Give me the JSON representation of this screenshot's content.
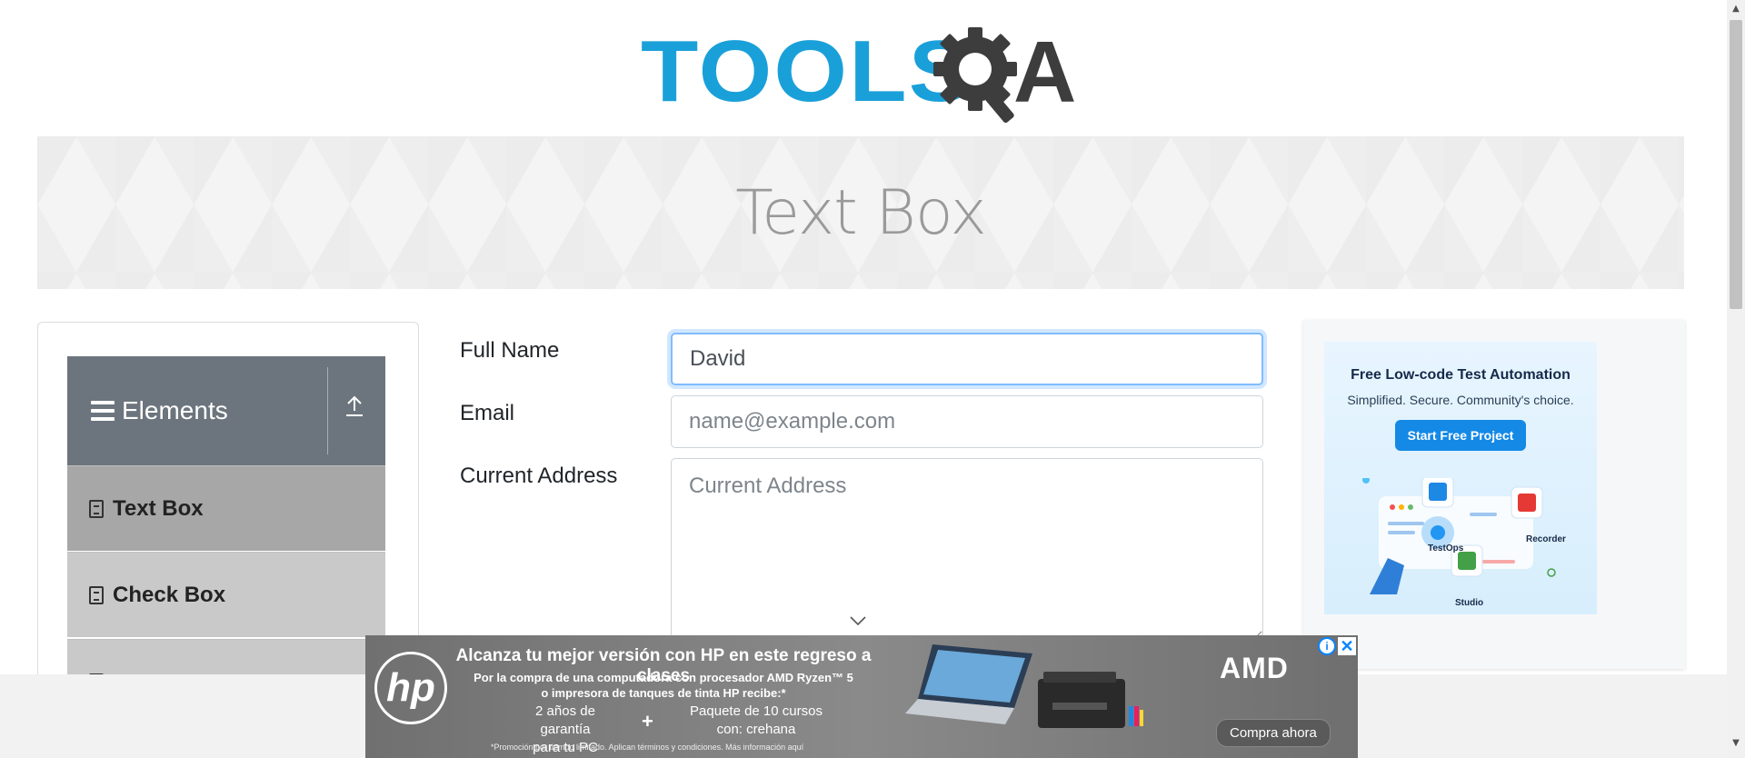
{
  "header": {
    "logo_left": "TOOLS",
    "logo_right": "A",
    "brand_colors": {
      "tools": "#1aa0d9",
      "qa": "#3d3d3d"
    }
  },
  "banner": {
    "title": "Text Box"
  },
  "sidebar": {
    "group_title": "Elements",
    "items": [
      {
        "label": "Text Box",
        "active": true
      },
      {
        "label": "Check Box",
        "active": false
      }
    ]
  },
  "form": {
    "full_name": {
      "label": "Full Name",
      "value": "David",
      "placeholder": ""
    },
    "email": {
      "label": "Email",
      "value": "",
      "placeholder": "name@example.com"
    },
    "current_address": {
      "label": "Current Address",
      "value": "",
      "placeholder": "Current Address"
    }
  },
  "ad_right": {
    "headline": "Free Low-code Test Automation",
    "subline": "Simplified. Secure. Community's choice.",
    "cta": "Start Free Project",
    "products": [
      "TestOps",
      "Recorder",
      "Studio"
    ]
  },
  "ad_bottom": {
    "headline": "Alcanza tu mejor versión con HP en este regreso a clases",
    "sub_line1": "Por la compra de una computadora con procesador AMD Ryzen™ 5",
    "sub_line2": "o impresora de tanques de tinta HP recibe:*",
    "offer1_line1": "2 años de garantía",
    "offer1_line2": "para tu PC",
    "plus": "+",
    "offer2_line1": "Paquete de 10 cursos",
    "offer2_line2": "con: crehana",
    "fine_print": "*Promoción por tiempo limitado. Aplican términos y condiciones. Más información aquí",
    "hp_logo": "hp",
    "amd_logo": "AMD",
    "cta": "Compra ahora",
    "adchoices": "i",
    "close": "✕"
  },
  "icons": {
    "hamburger": "hamburger-icon",
    "collapse": "upload-icon",
    "menu_item": "html5-icon",
    "chevron": "chevron-down-icon"
  }
}
